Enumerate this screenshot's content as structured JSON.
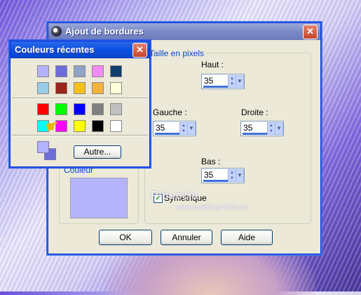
{
  "main_dialog": {
    "title": "Ajout de bordures",
    "close_glyph": "✕",
    "group_size_label": "Taille en pixels",
    "group_color_label": "Couleur",
    "color_value": "#b5b3f9",
    "fields": {
      "haut": {
        "label": "Haut :",
        "value": "35"
      },
      "gauche": {
        "label": "Gauche :",
        "value": "35"
      },
      "droite": {
        "label": "Droite :",
        "value": "35"
      },
      "bas": {
        "label": "Bas :",
        "value": "35"
      }
    },
    "symmetric": {
      "label": "Symétrique",
      "checked": true
    },
    "buttons": {
      "ok": "OK",
      "cancel": "Annuler",
      "help": "Aide"
    }
  },
  "recent_colors": {
    "title": "Couleurs récentes",
    "close_glyph": "✕",
    "recent_row1": [
      "#b4b2ff",
      "#6d6dd9",
      "#8fa3c6",
      "#f28af5",
      "#0e3f6b"
    ],
    "recent_row2": [
      "#98cde8",
      "#9a2519",
      "#f4c01c",
      "#f7b23b",
      "#ffffd8"
    ],
    "basic_row1": [
      "#ff0000",
      "#00ff00",
      "#0000ff",
      "#808080",
      "#c0c0c0"
    ],
    "basic_row2": [
      "#00ffff",
      "#ff00ff",
      "#ffff00",
      "#000000",
      "#ffffff"
    ],
    "current_fore": "#b4b2ff",
    "current_back": "#6d6dd9",
    "other_button": "Autre..."
  },
  "watermark": {
    "name": "Pinuccia",
    "url": "www.maidiregrafica.eu"
  }
}
